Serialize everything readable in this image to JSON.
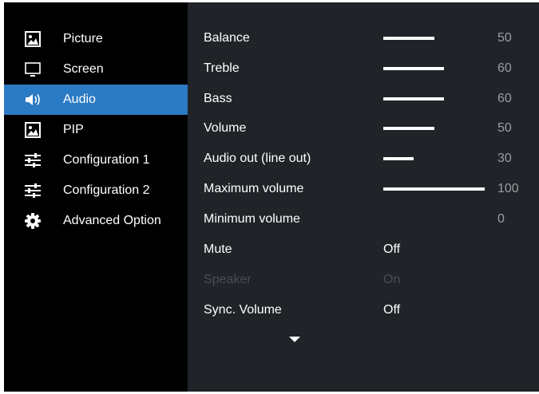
{
  "sidebar": {
    "items": [
      {
        "label": "Picture",
        "icon": "picture-icon"
      },
      {
        "label": "Screen",
        "icon": "monitor-icon"
      },
      {
        "label": "Audio",
        "icon": "speaker-icon",
        "active": true
      },
      {
        "label": "PIP",
        "icon": "picture-icon"
      },
      {
        "label": "Configuration 1",
        "icon": "sliders-icon"
      },
      {
        "label": "Configuration 2",
        "icon": "sliders-icon"
      },
      {
        "label": "Advanced Option",
        "icon": "gear-icon"
      }
    ]
  },
  "audio": {
    "rows": [
      {
        "label": "Balance",
        "value": "50",
        "level": 50
      },
      {
        "label": "Treble",
        "value": "60",
        "level": 60
      },
      {
        "label": "Bass",
        "value": "60",
        "level": 60
      },
      {
        "label": "Volume",
        "value": "50",
        "level": 50
      },
      {
        "label": "Audio out (line out)",
        "value": "30",
        "level": 30
      },
      {
        "label": "Maximum volume",
        "value": "100",
        "level": 100
      },
      {
        "label": "Minimum volume",
        "value": "0",
        "level": 0
      },
      {
        "label": "Mute",
        "option": "Off"
      },
      {
        "label": "Speaker",
        "option": "On",
        "disabled": true
      },
      {
        "label": "Sync. Volume",
        "option": "Off"
      }
    ]
  },
  "colors": {
    "active": "#2b7ac4",
    "panel": "#202328",
    "sidebar": "#000000"
  }
}
